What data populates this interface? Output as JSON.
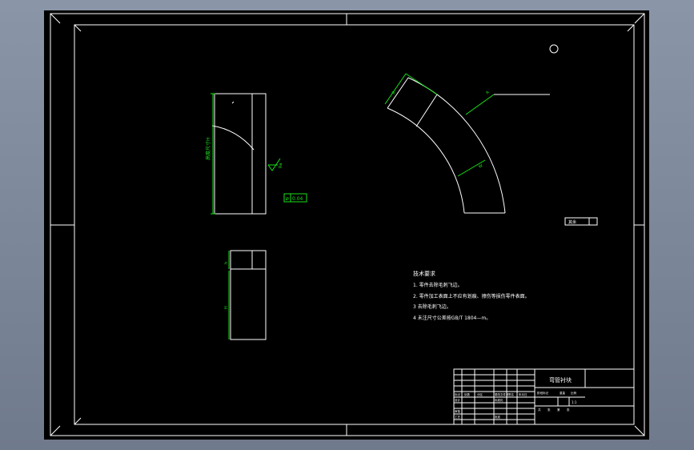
{
  "drawing": {
    "colors": {
      "viewport_background": "#000000",
      "frame_line": "#ffffff",
      "dimension_green": "#18e018",
      "app_background": "#7f8b9d"
    },
    "dimensions": {
      "left_view_height": "高度尺寸H",
      "tolerance_frame_symbol": "⌀",
      "tolerance_frame_value": "0.04",
      "arc_radius_label": "R",
      "arc_thickness_label": "B",
      "arc_width_label": "W",
      "bottom_top_height": "h",
      "bottom_main_height": "H"
    },
    "roughness_mark": "Ra",
    "roughness_note": "其余",
    "tech_requirements": {
      "title": "技术要求",
      "items": [
        "1. 零件去除毛刺飞边。",
        "2. 零件加工表面上不应有划痕、擦伤等损伤零件表面。",
        "3  去除毛刺飞边。",
        "4  未注尺寸公差按GB/T 1804—m。"
      ]
    },
    "title_block": {
      "part_name": "弯管衬块",
      "left_grid_labels": [
        "标记",
        "处数",
        "分区",
        "更改文件号",
        "签名",
        "年月日",
        "设计",
        "标准化",
        "审核",
        "工艺",
        "批准"
      ],
      "right_labels": [
        "阶段标记",
        "重量",
        "比例"
      ],
      "scale_value": "1:1",
      "sheet_labels": [
        "共",
        "张",
        "第",
        "张"
      ]
    }
  }
}
